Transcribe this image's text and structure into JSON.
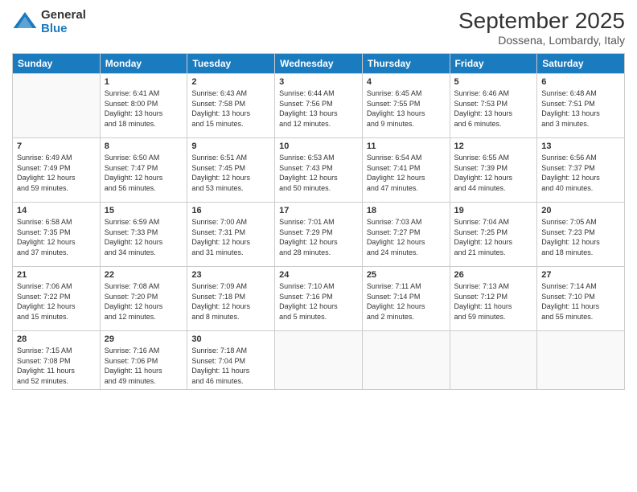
{
  "logo": {
    "line1": "General",
    "line2": "Blue"
  },
  "title": "September 2025",
  "location": "Dossena, Lombardy, Italy",
  "weekdays": [
    "Sunday",
    "Monday",
    "Tuesday",
    "Wednesday",
    "Thursday",
    "Friday",
    "Saturday"
  ],
  "weeks": [
    [
      {
        "day": "",
        "info": ""
      },
      {
        "day": "1",
        "info": "Sunrise: 6:41 AM\nSunset: 8:00 PM\nDaylight: 13 hours\nand 18 minutes."
      },
      {
        "day": "2",
        "info": "Sunrise: 6:43 AM\nSunset: 7:58 PM\nDaylight: 13 hours\nand 15 minutes."
      },
      {
        "day": "3",
        "info": "Sunrise: 6:44 AM\nSunset: 7:56 PM\nDaylight: 13 hours\nand 12 minutes."
      },
      {
        "day": "4",
        "info": "Sunrise: 6:45 AM\nSunset: 7:55 PM\nDaylight: 13 hours\nand 9 minutes."
      },
      {
        "day": "5",
        "info": "Sunrise: 6:46 AM\nSunset: 7:53 PM\nDaylight: 13 hours\nand 6 minutes."
      },
      {
        "day": "6",
        "info": "Sunrise: 6:48 AM\nSunset: 7:51 PM\nDaylight: 13 hours\nand 3 minutes."
      }
    ],
    [
      {
        "day": "7",
        "info": "Sunrise: 6:49 AM\nSunset: 7:49 PM\nDaylight: 12 hours\nand 59 minutes."
      },
      {
        "day": "8",
        "info": "Sunrise: 6:50 AM\nSunset: 7:47 PM\nDaylight: 12 hours\nand 56 minutes."
      },
      {
        "day": "9",
        "info": "Sunrise: 6:51 AM\nSunset: 7:45 PM\nDaylight: 12 hours\nand 53 minutes."
      },
      {
        "day": "10",
        "info": "Sunrise: 6:53 AM\nSunset: 7:43 PM\nDaylight: 12 hours\nand 50 minutes."
      },
      {
        "day": "11",
        "info": "Sunrise: 6:54 AM\nSunset: 7:41 PM\nDaylight: 12 hours\nand 47 minutes."
      },
      {
        "day": "12",
        "info": "Sunrise: 6:55 AM\nSunset: 7:39 PM\nDaylight: 12 hours\nand 44 minutes."
      },
      {
        "day": "13",
        "info": "Sunrise: 6:56 AM\nSunset: 7:37 PM\nDaylight: 12 hours\nand 40 minutes."
      }
    ],
    [
      {
        "day": "14",
        "info": "Sunrise: 6:58 AM\nSunset: 7:35 PM\nDaylight: 12 hours\nand 37 minutes."
      },
      {
        "day": "15",
        "info": "Sunrise: 6:59 AM\nSunset: 7:33 PM\nDaylight: 12 hours\nand 34 minutes."
      },
      {
        "day": "16",
        "info": "Sunrise: 7:00 AM\nSunset: 7:31 PM\nDaylight: 12 hours\nand 31 minutes."
      },
      {
        "day": "17",
        "info": "Sunrise: 7:01 AM\nSunset: 7:29 PM\nDaylight: 12 hours\nand 28 minutes."
      },
      {
        "day": "18",
        "info": "Sunrise: 7:03 AM\nSunset: 7:27 PM\nDaylight: 12 hours\nand 24 minutes."
      },
      {
        "day": "19",
        "info": "Sunrise: 7:04 AM\nSunset: 7:25 PM\nDaylight: 12 hours\nand 21 minutes."
      },
      {
        "day": "20",
        "info": "Sunrise: 7:05 AM\nSunset: 7:23 PM\nDaylight: 12 hours\nand 18 minutes."
      }
    ],
    [
      {
        "day": "21",
        "info": "Sunrise: 7:06 AM\nSunset: 7:22 PM\nDaylight: 12 hours\nand 15 minutes."
      },
      {
        "day": "22",
        "info": "Sunrise: 7:08 AM\nSunset: 7:20 PM\nDaylight: 12 hours\nand 12 minutes."
      },
      {
        "day": "23",
        "info": "Sunrise: 7:09 AM\nSunset: 7:18 PM\nDaylight: 12 hours\nand 8 minutes."
      },
      {
        "day": "24",
        "info": "Sunrise: 7:10 AM\nSunset: 7:16 PM\nDaylight: 12 hours\nand 5 minutes."
      },
      {
        "day": "25",
        "info": "Sunrise: 7:11 AM\nSunset: 7:14 PM\nDaylight: 12 hours\nand 2 minutes."
      },
      {
        "day": "26",
        "info": "Sunrise: 7:13 AM\nSunset: 7:12 PM\nDaylight: 11 hours\nand 59 minutes."
      },
      {
        "day": "27",
        "info": "Sunrise: 7:14 AM\nSunset: 7:10 PM\nDaylight: 11 hours\nand 55 minutes."
      }
    ],
    [
      {
        "day": "28",
        "info": "Sunrise: 7:15 AM\nSunset: 7:08 PM\nDaylight: 11 hours\nand 52 minutes."
      },
      {
        "day": "29",
        "info": "Sunrise: 7:16 AM\nSunset: 7:06 PM\nDaylight: 11 hours\nand 49 minutes."
      },
      {
        "day": "30",
        "info": "Sunrise: 7:18 AM\nSunset: 7:04 PM\nDaylight: 11 hours\nand 46 minutes."
      },
      {
        "day": "",
        "info": ""
      },
      {
        "day": "",
        "info": ""
      },
      {
        "day": "",
        "info": ""
      },
      {
        "day": "",
        "info": ""
      }
    ]
  ]
}
